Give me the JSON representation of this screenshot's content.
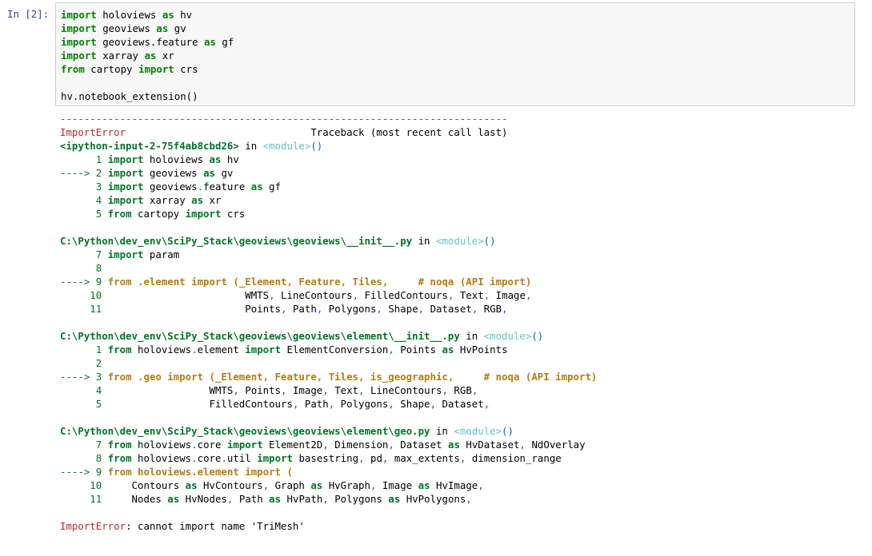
{
  "cell": {
    "prompt": "In [2]:",
    "code_lines": [
      [
        {
          "t": "import",
          "c": "kw"
        },
        {
          "t": " holoviews "
        },
        {
          "t": "as",
          "c": "kw"
        },
        {
          "t": " hv"
        }
      ],
      [
        {
          "t": "import",
          "c": "kw"
        },
        {
          "t": " geoviews "
        },
        {
          "t": "as",
          "c": "kw"
        },
        {
          "t": " gv"
        }
      ],
      [
        {
          "t": "import",
          "c": "kw"
        },
        {
          "t": " geoviews.feature "
        },
        {
          "t": "as",
          "c": "kw"
        },
        {
          "t": " gf"
        }
      ],
      [
        {
          "t": "import",
          "c": "kw"
        },
        {
          "t": " xarray "
        },
        {
          "t": "as",
          "c": "kw"
        },
        {
          "t": " xr"
        }
      ],
      [
        {
          "t": "from",
          "c": "kw"
        },
        {
          "t": " cartopy "
        },
        {
          "t": "import",
          "c": "kw"
        },
        {
          "t": " crs"
        }
      ],
      [
        {
          "t": ""
        }
      ],
      [
        {
          "t": "hv.notebook_extension()"
        }
      ]
    ]
  },
  "output": {
    "lines": [
      [
        {
          "t": "---------------------------------------------------------------------------",
          "c": "red"
        }
      ],
      [
        {
          "t": "ImportError",
          "c": "red"
        },
        {
          "t": "                               Traceback (most recent call last)"
        }
      ],
      [
        {
          "t": "<ipython-input-2-75f4ab8cbd26>",
          "c": "grn"
        },
        {
          "t": " in "
        },
        {
          "t": "<module>",
          "c": "cyn"
        },
        {
          "t": "()",
          "c": "blu"
        }
      ],
      [
        {
          "t": "      1 ",
          "c": "grnn"
        },
        {
          "t": "import",
          "c": "grn"
        },
        {
          "t": " holoviews "
        },
        {
          "t": "as",
          "c": "grn"
        },
        {
          "t": " hv"
        }
      ],
      [
        {
          "t": "----> 2 ",
          "c": "grnn"
        },
        {
          "t": "import",
          "c": "grn"
        },
        {
          "t": " geoviews "
        },
        {
          "t": "as",
          "c": "grn"
        },
        {
          "t": " gv"
        }
      ],
      [
        {
          "t": "      3 ",
          "c": "grnn"
        },
        {
          "t": "import",
          "c": "grn"
        },
        {
          "t": " geoviews"
        },
        {
          "t": ".",
          "c": "blu"
        },
        {
          "t": "feature "
        },
        {
          "t": "as",
          "c": "grn"
        },
        {
          "t": " gf"
        }
      ],
      [
        {
          "t": "      4 ",
          "c": "grnn"
        },
        {
          "t": "import",
          "c": "grn"
        },
        {
          "t": " xarray "
        },
        {
          "t": "as",
          "c": "grn"
        },
        {
          "t": " xr"
        }
      ],
      [
        {
          "t": "      5 ",
          "c": "grnn"
        },
        {
          "t": "from",
          "c": "grn"
        },
        {
          "t": " cartopy "
        },
        {
          "t": "import",
          "c": "grn"
        },
        {
          "t": " crs"
        }
      ],
      [
        {
          "t": ""
        }
      ],
      [
        {
          "t": "C:\\Python\\dev_env\\SciPy_Stack\\geoviews\\geoviews\\__init__.py",
          "c": "grn"
        },
        {
          "t": " in "
        },
        {
          "t": "<module>",
          "c": "cyn"
        },
        {
          "t": "()",
          "c": "blu"
        }
      ],
      [
        {
          "t": "      7 ",
          "c": "grnn"
        },
        {
          "t": "import",
          "c": "grn"
        },
        {
          "t": " param"
        }
      ],
      [
        {
          "t": "      8 ",
          "c": "grnn"
        }
      ],
      [
        {
          "t": "----> 9 ",
          "c": "grnn"
        },
        {
          "t": "from",
          "c": "ylw"
        },
        {
          "t": " .element ",
          "c": "ylw"
        },
        {
          "t": "import",
          "c": "ylw"
        },
        {
          "t": " (_Element, Feature, Tiles,     # noqa (API import)",
          "c": "ylw"
        }
      ],
      [
        {
          "t": "     10 ",
          "c": "grnn"
        },
        {
          "t": "                       WMTS"
        },
        {
          "t": ",",
          "c": "blu"
        },
        {
          "t": " LineContours"
        },
        {
          "t": ",",
          "c": "blu"
        },
        {
          "t": " FilledContours"
        },
        {
          "t": ",",
          "c": "blu"
        },
        {
          "t": " Text"
        },
        {
          "t": ",",
          "c": "blu"
        },
        {
          "t": " Image"
        },
        {
          "t": ",",
          "c": "blu"
        }
      ],
      [
        {
          "t": "     11 ",
          "c": "grnn"
        },
        {
          "t": "                       Points"
        },
        {
          "t": ",",
          "c": "blu"
        },
        {
          "t": " Path"
        },
        {
          "t": ",",
          "c": "blu"
        },
        {
          "t": " Polygons"
        },
        {
          "t": ",",
          "c": "blu"
        },
        {
          "t": " Shape"
        },
        {
          "t": ",",
          "c": "blu"
        },
        {
          "t": " Dataset"
        },
        {
          "t": ",",
          "c": "blu"
        },
        {
          "t": " RGB"
        },
        {
          "t": ",",
          "c": "blu"
        }
      ],
      [
        {
          "t": ""
        }
      ],
      [
        {
          "t": "C:\\Python\\dev_env\\SciPy_Stack\\geoviews\\geoviews\\element\\__init__.py",
          "c": "grn"
        },
        {
          "t": " in "
        },
        {
          "t": "<module>",
          "c": "cyn"
        },
        {
          "t": "()",
          "c": "blu"
        }
      ],
      [
        {
          "t": "      1 ",
          "c": "grnn"
        },
        {
          "t": "from",
          "c": "grn"
        },
        {
          "t": " holoviews"
        },
        {
          "t": ".",
          "c": "blu"
        },
        {
          "t": "element "
        },
        {
          "t": "import",
          "c": "grn"
        },
        {
          "t": " ElementConversion"
        },
        {
          "t": ",",
          "c": "blu"
        },
        {
          "t": " Points "
        },
        {
          "t": "as",
          "c": "grn"
        },
        {
          "t": " HvPoints"
        }
      ],
      [
        {
          "t": "      2 ",
          "c": "grnn"
        }
      ],
      [
        {
          "t": "----> 3 ",
          "c": "grnn"
        },
        {
          "t": "from .geo import (_Element, Feature, Tiles, is_geographic,     # noqa (API import)",
          "c": "ylw"
        }
      ],
      [
        {
          "t": "      4 ",
          "c": "grnn"
        },
        {
          "t": "                 WMTS"
        },
        {
          "t": ",",
          "c": "blu"
        },
        {
          "t": " Points"
        },
        {
          "t": ",",
          "c": "blu"
        },
        {
          "t": " Image"
        },
        {
          "t": ",",
          "c": "blu"
        },
        {
          "t": " Text"
        },
        {
          "t": ",",
          "c": "blu"
        },
        {
          "t": " LineContours"
        },
        {
          "t": ",",
          "c": "blu"
        },
        {
          "t": " RGB"
        },
        {
          "t": ",",
          "c": "blu"
        }
      ],
      [
        {
          "t": "      5 ",
          "c": "grnn"
        },
        {
          "t": "                 FilledContours"
        },
        {
          "t": ",",
          "c": "blu"
        },
        {
          "t": " Path"
        },
        {
          "t": ",",
          "c": "blu"
        },
        {
          "t": " Polygons"
        },
        {
          "t": ",",
          "c": "blu"
        },
        {
          "t": " Shape"
        },
        {
          "t": ",",
          "c": "blu"
        },
        {
          "t": " Dataset"
        },
        {
          "t": ",",
          "c": "blu"
        }
      ],
      [
        {
          "t": ""
        }
      ],
      [
        {
          "t": "C:\\Python\\dev_env\\SciPy_Stack\\geoviews\\geoviews\\element\\geo.py",
          "c": "grn"
        },
        {
          "t": " in "
        },
        {
          "t": "<module>",
          "c": "cyn"
        },
        {
          "t": "()",
          "c": "blu"
        }
      ],
      [
        {
          "t": "      7 ",
          "c": "grnn"
        },
        {
          "t": "from",
          "c": "grn"
        },
        {
          "t": " holoviews"
        },
        {
          "t": ".",
          "c": "blu"
        },
        {
          "t": "core "
        },
        {
          "t": "import",
          "c": "grn"
        },
        {
          "t": " Element2D"
        },
        {
          "t": ",",
          "c": "blu"
        },
        {
          "t": " Dimension"
        },
        {
          "t": ",",
          "c": "blu"
        },
        {
          "t": " Dataset "
        },
        {
          "t": "as",
          "c": "grn"
        },
        {
          "t": " HvDataset"
        },
        {
          "t": ",",
          "c": "blu"
        },
        {
          "t": " NdOverlay"
        }
      ],
      [
        {
          "t": "      8 ",
          "c": "grnn"
        },
        {
          "t": "from",
          "c": "grn"
        },
        {
          "t": " holoviews"
        },
        {
          "t": ".",
          "c": "blu"
        },
        {
          "t": "core"
        },
        {
          "t": ".",
          "c": "blu"
        },
        {
          "t": "util "
        },
        {
          "t": "import",
          "c": "grn"
        },
        {
          "t": " basestring"
        },
        {
          "t": ",",
          "c": "blu"
        },
        {
          "t": " pd"
        },
        {
          "t": ",",
          "c": "blu"
        },
        {
          "t": " max_extents"
        },
        {
          "t": ",",
          "c": "blu"
        },
        {
          "t": " dimension_range"
        }
      ],
      [
        {
          "t": "----> 9 ",
          "c": "grnn"
        },
        {
          "t": "from holoviews.element import (",
          "c": "ylw"
        }
      ],
      [
        {
          "t": "     10 ",
          "c": "grnn"
        },
        {
          "t": "    Contours "
        },
        {
          "t": "as",
          "c": "grn"
        },
        {
          "t": " HvContours"
        },
        {
          "t": ",",
          "c": "blu"
        },
        {
          "t": " Graph "
        },
        {
          "t": "as",
          "c": "grn"
        },
        {
          "t": " HvGraph"
        },
        {
          "t": ",",
          "c": "blu"
        },
        {
          "t": " Image "
        },
        {
          "t": "as",
          "c": "grn"
        },
        {
          "t": " HvImage"
        },
        {
          "t": ",",
          "c": "blu"
        }
      ],
      [
        {
          "t": "     11 ",
          "c": "grnn"
        },
        {
          "t": "    Nodes "
        },
        {
          "t": "as",
          "c": "grn"
        },
        {
          "t": " HvNodes"
        },
        {
          "t": ",",
          "c": "blu"
        },
        {
          "t": " Path "
        },
        {
          "t": "as",
          "c": "grn"
        },
        {
          "t": " HvPath"
        },
        {
          "t": ",",
          "c": "blu"
        },
        {
          "t": " Polygons "
        },
        {
          "t": "as",
          "c": "grn"
        },
        {
          "t": " HvPolygons"
        },
        {
          "t": ",",
          "c": "blu"
        }
      ],
      [
        {
          "t": ""
        }
      ],
      [
        {
          "t": "ImportError",
          "c": "red"
        },
        {
          "t": ": cannot import name 'TriMesh'"
        }
      ]
    ]
  }
}
